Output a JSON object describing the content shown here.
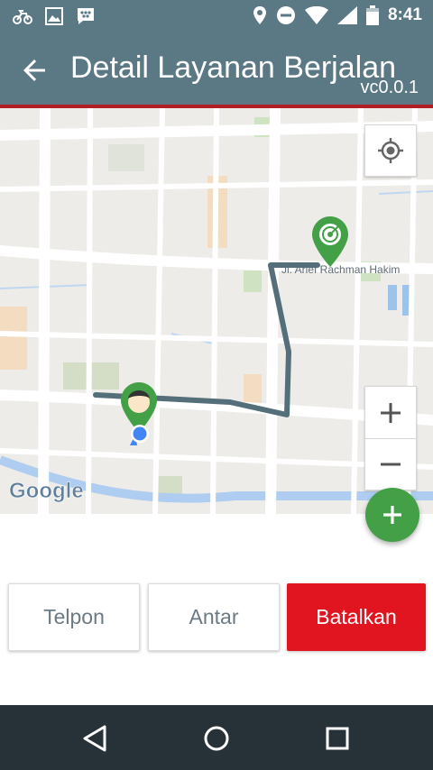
{
  "status_bar": {
    "time": "8:41",
    "left_icons": [
      "bike-notification-icon",
      "image-notification-icon",
      "bbm-chat-icon"
    ],
    "right_icons": [
      "location-icon",
      "do-not-disturb-icon",
      "wifi-icon",
      "signal-icon",
      "battery-icon"
    ]
  },
  "app_bar": {
    "title": "Detail Layanan Berjalan",
    "version": "vc0.0.1",
    "back_icon": "arrow-back-icon"
  },
  "map": {
    "street_label": "Jl. Arief Rachman Hakim",
    "logo": "Google",
    "buttons": [
      "my-location-icon",
      "plus-icon",
      "minus-icon"
    ],
    "route_color": "#546e7a",
    "pin_color": "#43a047"
  },
  "fab": {
    "icon": "plus-icon",
    "color": "#43a047"
  },
  "actions": {
    "telpon": "Telpon",
    "antar": "Antar",
    "batalkan": "Batalkan"
  },
  "nav_bar": {
    "icons": [
      "back-triangle-icon",
      "home-circle-icon",
      "recents-square-icon"
    ]
  }
}
